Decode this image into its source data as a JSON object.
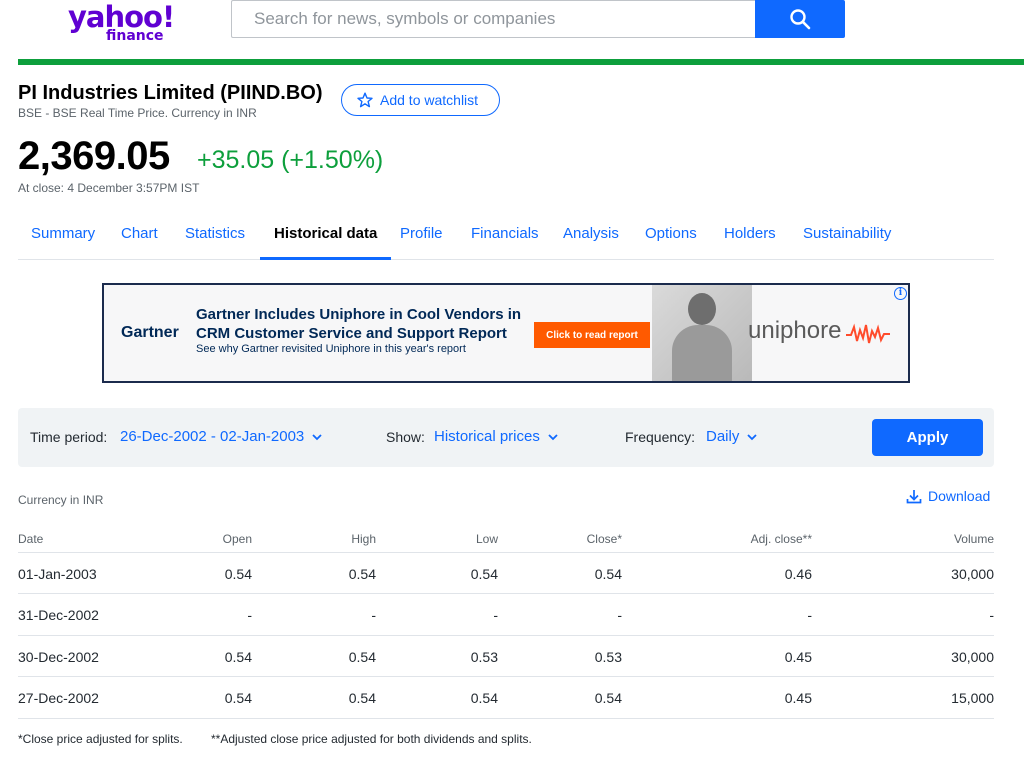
{
  "header": {
    "logo_main": "yahoo!",
    "logo_sub": "finance",
    "search_placeholder": "Search for news, symbols or companies"
  },
  "quote": {
    "title": "PI Industries Limited (PIIND.BO)",
    "subtitle": "BSE - BSE Real Time Price. Currency in INR",
    "watchlist_label": "Add to watchlist",
    "price": "2,369.05",
    "change": "+35.05 (+1.50%)",
    "close_time": "At close: 4 December 3:57PM IST"
  },
  "tabs": [
    {
      "label": "Summary"
    },
    {
      "label": "Chart"
    },
    {
      "label": "Statistics"
    },
    {
      "label": "Historical data"
    },
    {
      "label": "Profile"
    },
    {
      "label": "Financials"
    },
    {
      "label": "Analysis"
    },
    {
      "label": "Options"
    },
    {
      "label": "Holders"
    },
    {
      "label": "Sustainability"
    }
  ],
  "active_tab": "Historical data",
  "ad": {
    "brand": "Gartner",
    "headline": "Gartner Includes Uniphore in Cool Vendors in CRM Customer Service and Support Report",
    "subline": "See why Gartner revisited Uniphore in this year's report",
    "cta": "Click to read report",
    "advertiser": "uniphore",
    "info_icon": "i"
  },
  "controls": {
    "time_period_label": "Time period:",
    "time_period_value": "26-Dec-2002 - 02-Jan-2003",
    "show_label": "Show:",
    "show_value": "Historical prices",
    "frequency_label": "Frequency:",
    "frequency_value": "Daily",
    "apply_label": "Apply"
  },
  "currency_note": "Currency in INR",
  "download_label": "Download",
  "table": {
    "headers": [
      "Date",
      "Open",
      "High",
      "Low",
      "Close*",
      "Adj. close**",
      "Volume"
    ],
    "rows": [
      [
        "01-Jan-2003",
        "0.54",
        "0.54",
        "0.54",
        "0.54",
        "0.46",
        "30,000"
      ],
      [
        "31-Dec-2002",
        "-",
        "-",
        "-",
        "-",
        "-",
        "-"
      ],
      [
        "30-Dec-2002",
        "0.54",
        "0.54",
        "0.53",
        "0.53",
        "0.45",
        "30,000"
      ],
      [
        "27-Dec-2002",
        "0.54",
        "0.54",
        "0.54",
        "0.54",
        "0.45",
        "15,000"
      ]
    ]
  },
  "footnotes": [
    "*Close price adjusted for splits.",
    "**Adjusted close price adjusted for both dividends and splits."
  ],
  "colors": {
    "accent_blue": "#0f69ff",
    "brand_purple": "#6001d2",
    "positive_green": "#0d9f3c",
    "ad_cta_orange": "#ff5a00"
  }
}
